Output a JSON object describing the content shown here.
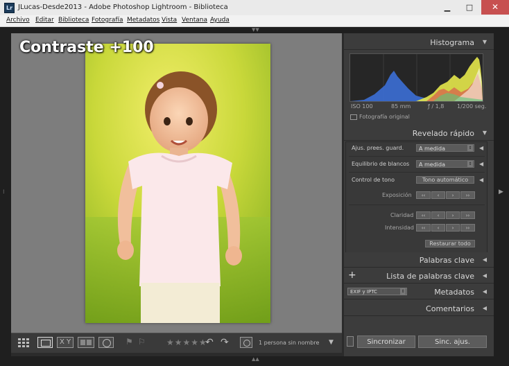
{
  "window": {
    "title": "JLucas-Desde2013 - Adobe Photoshop Lightroom - Biblioteca",
    "app_icon": "Lr",
    "minimize": "▁",
    "maximize": "□",
    "close": "✕"
  },
  "menu": [
    "Archivo",
    "Editar",
    "Biblioteca",
    "Fotografía",
    "Metadatos",
    "Vista",
    "Ventana",
    "Ayuda"
  ],
  "overlay": "Contraste +100",
  "toolbar": {
    "face_text": "1 persona sin nombre",
    "stars": "★★★★★",
    "icons": [
      "grid-view-icon",
      "loupe-view-icon",
      "compare-view-icon",
      "survey-view-icon",
      "people-view-icon",
      "flag-icon",
      "reject-flag-icon",
      "rotate-left-icon",
      "rotate-right-icon",
      "face-detect-icon"
    ]
  },
  "histogram": {
    "title": "Histograma",
    "iso": "ISO 100",
    "focal": "85 mm",
    "aperture": "ƒ / 1,8",
    "shutter": "1/200 seg.",
    "original_label": "Fotografía original"
  },
  "quick_develop": {
    "title": "Revelado rápido",
    "preset_label": "Ajus. prees. guard.",
    "preset_value": "A medida",
    "wb_label": "Equilibrio de blancos",
    "wb_value": "A medida",
    "tone_label": "Control de tono",
    "auto_tone": "Tono automático",
    "exposure": "Exposición",
    "clarity": "Claridad",
    "vibrance": "Intensidad",
    "reset_all": "Restaurar todo",
    "step_labels": [
      "‹‹",
      "‹",
      "›",
      "››"
    ]
  },
  "panels": {
    "keywording": "Palabras clave",
    "keyword_list": "Lista de palabras clave",
    "metadata": "Metadatos",
    "metadata_preset": "EXIF y IPTC",
    "comments": "Comentarios",
    "plus": "+"
  },
  "sync": {
    "sync_button": "Sincronizar",
    "sync_settings_button": "Sinc. ajus."
  },
  "colors": {
    "panel_bg": "#3c3c3c",
    "loupe_bg": "#7d7d7d",
    "close_red": "#c75050",
    "histogram_blue": "#3c6fd6",
    "histogram_yellow": "#e6e84b",
    "histogram_red": "#d8424e"
  }
}
